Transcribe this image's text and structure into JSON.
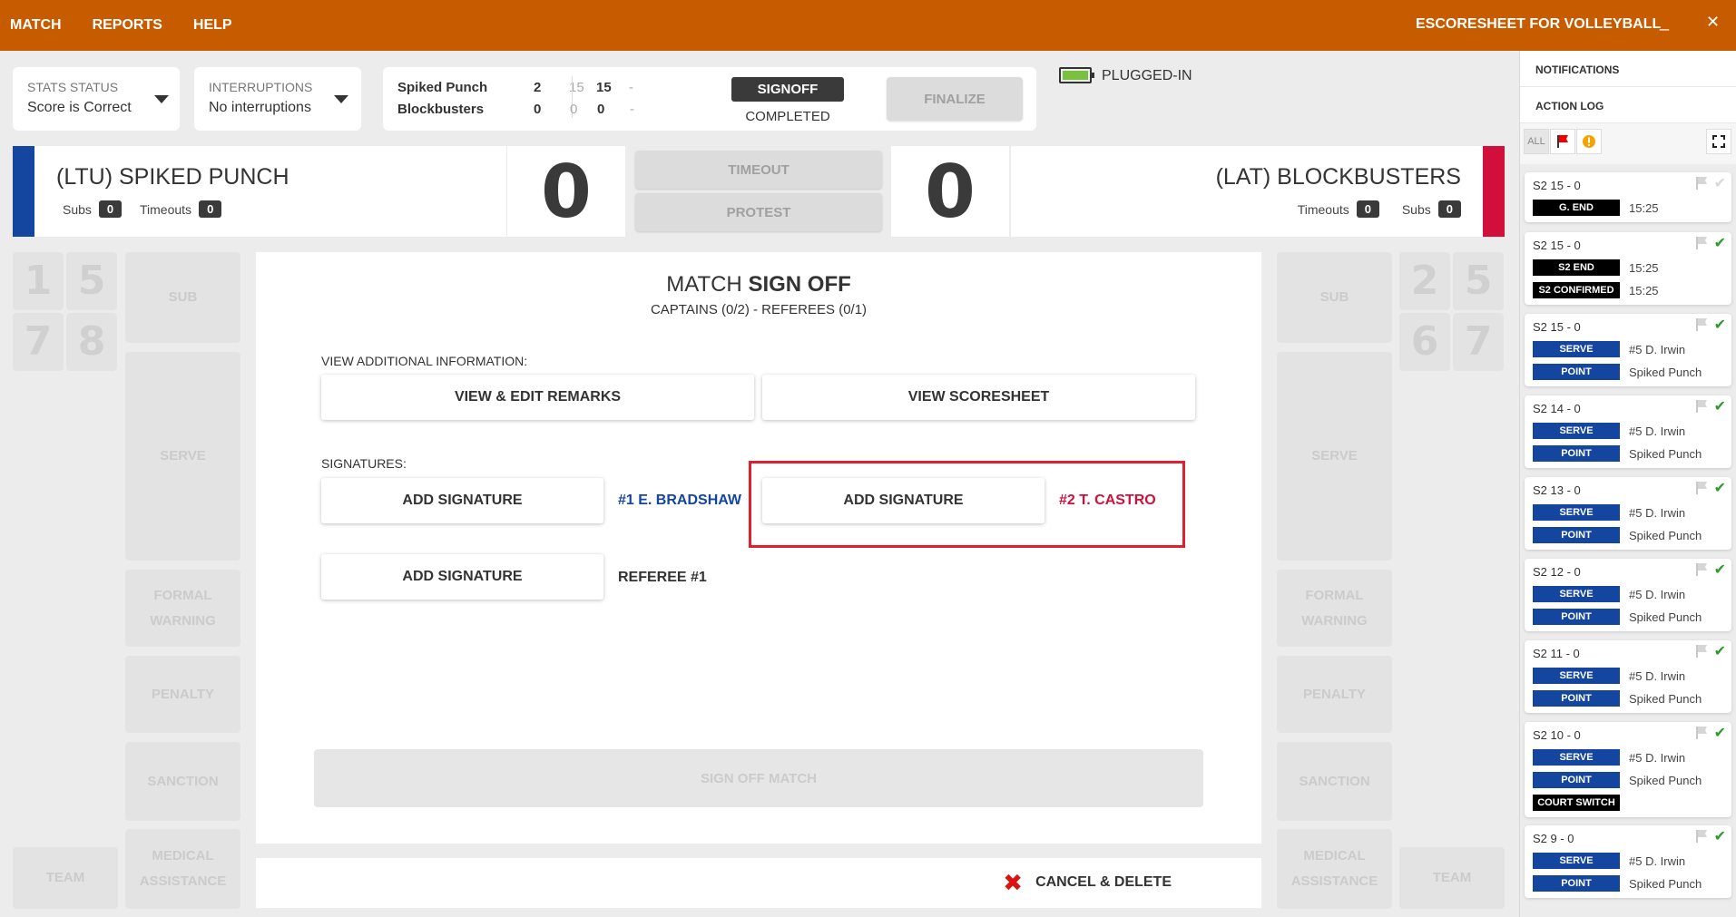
{
  "topbar": {
    "nav": [
      "MATCH",
      "REPORTS",
      "HELP"
    ],
    "app_title": "ESCORESHEET FOR VOLLEYBALL",
    "minimize": "_",
    "close": "✕"
  },
  "stats_status": {
    "label": "STATS STATUS",
    "value": "Score is Correct"
  },
  "interruptions": {
    "label": "INTERRUPTIONS",
    "value": "No interruptions"
  },
  "scoreboard": {
    "team1": {
      "name": "Spiked Punch",
      "sets": "2",
      "s1": "15",
      "s2": "15",
      "s3": "-"
    },
    "team2": {
      "name": "Blockbusters",
      "sets": "0",
      "s1": "0",
      "s2": "0",
      "s3": "-"
    }
  },
  "signoff_badge": "SIGNOFF",
  "completed": "COMPLETED",
  "finalize": "FINALIZE",
  "power": {
    "label": "PLUGGED-IN",
    "battery_color": "#7ac142"
  },
  "left_team": {
    "name": "(LTU) SPIKED PUNCH",
    "subs_label": "Subs",
    "subs": "0",
    "timeouts_label": "Timeouts",
    "timeouts": "0",
    "color": "#1446a0",
    "score": "0"
  },
  "right_team": {
    "name": "(LAT) BLOCKBUSTERS",
    "subs_label": "Subs",
    "subs": "0",
    "timeouts_label": "Timeouts",
    "timeouts": "0",
    "color": "#d0103a",
    "score": "0"
  },
  "center_buttons": {
    "timeout": "TIMEOUT",
    "protest": "PROTEST"
  },
  "left_players": [
    "1",
    "5",
    "7",
    "8"
  ],
  "right_players": [
    "2",
    "5",
    "6",
    "7"
  ],
  "side_tiles": {
    "sub": "SUB",
    "serve": "SERVE",
    "formal_warning": "FORMAL WARNING",
    "penalty": "PENALTY",
    "sanction": "SANCTION",
    "medical": "MEDICAL ASSISTANCE",
    "team": "TEAM"
  },
  "main": {
    "title_light": "MATCH",
    "title_bold": "SIGN OFF",
    "subtitle": "CAPTAINS (0/2) - REFEREES (0/1)",
    "view_label": "VIEW ADDITIONAL INFORMATION:",
    "view_remarks": "VIEW & EDIT REMARKS",
    "view_scoresheet": "VIEW SCORESHEET",
    "signatures_label": "SIGNATURES:",
    "add_signature": "ADD SIGNATURE",
    "captain1": "#1 E. BRADSHAW",
    "captain2": "#2 T. CASTRO",
    "referee": "REFEREE #1",
    "sign_off_match": "SIGN OFF MATCH",
    "cancel_delete": "CANCEL & DELETE"
  },
  "right_panel": {
    "notifications": "NOTIFICATIONS",
    "action_log": "ACTION LOG",
    "filter_all": "ALL",
    "log": [
      {
        "header": "S2  15 - 0",
        "confirmed": false,
        "events": [
          {
            "label": "G. END",
            "color": "#000000",
            "text": "15:25"
          }
        ]
      },
      {
        "header": "S2  15 - 0",
        "confirmed": true,
        "events": [
          {
            "label": "S2 END",
            "color": "#000000",
            "text": "15:25"
          },
          {
            "label": "S2 CONFIRMED",
            "color": "#000000",
            "text": "15:25"
          }
        ]
      },
      {
        "header": "S2  15 - 0",
        "confirmed": true,
        "events": [
          {
            "label": "SERVE",
            "color": "#1446a0",
            "text": "#5 D. Irwin"
          },
          {
            "label": "POINT",
            "color": "#1446a0",
            "text": "Spiked Punch"
          }
        ]
      },
      {
        "header": "S2  14 - 0",
        "confirmed": true,
        "events": [
          {
            "label": "SERVE",
            "color": "#1446a0",
            "text": "#5 D. Irwin"
          },
          {
            "label": "POINT",
            "color": "#1446a0",
            "text": "Spiked Punch"
          }
        ]
      },
      {
        "header": "S2  13 - 0",
        "confirmed": true,
        "events": [
          {
            "label": "SERVE",
            "color": "#1446a0",
            "text": "#5 D. Irwin"
          },
          {
            "label": "POINT",
            "color": "#1446a0",
            "text": "Spiked Punch"
          }
        ]
      },
      {
        "header": "S2  12 - 0",
        "confirmed": true,
        "events": [
          {
            "label": "SERVE",
            "color": "#1446a0",
            "text": "#5 D. Irwin"
          },
          {
            "label": "POINT",
            "color": "#1446a0",
            "text": "Spiked Punch"
          }
        ]
      },
      {
        "header": "S2  11 - 0",
        "confirmed": true,
        "events": [
          {
            "label": "SERVE",
            "color": "#1446a0",
            "text": "#5 D. Irwin"
          },
          {
            "label": "POINT",
            "color": "#1446a0",
            "text": "Spiked Punch"
          }
        ]
      },
      {
        "header": "S2  10 - 0",
        "confirmed": true,
        "events": [
          {
            "label": "SERVE",
            "color": "#1446a0",
            "text": "#5 D. Irwin"
          },
          {
            "label": "POINT",
            "color": "#1446a0",
            "text": "Spiked Punch"
          },
          {
            "label": "COURT SWITCH",
            "color": "#000000",
            "text": ""
          }
        ]
      },
      {
        "header": "S2  9 - 0",
        "confirmed": true,
        "events": [
          {
            "label": "SERVE",
            "color": "#1446a0",
            "text": "#5 D. Irwin"
          },
          {
            "label": "POINT",
            "color": "#1446a0",
            "text": "Spiked Punch"
          }
        ]
      }
    ]
  }
}
